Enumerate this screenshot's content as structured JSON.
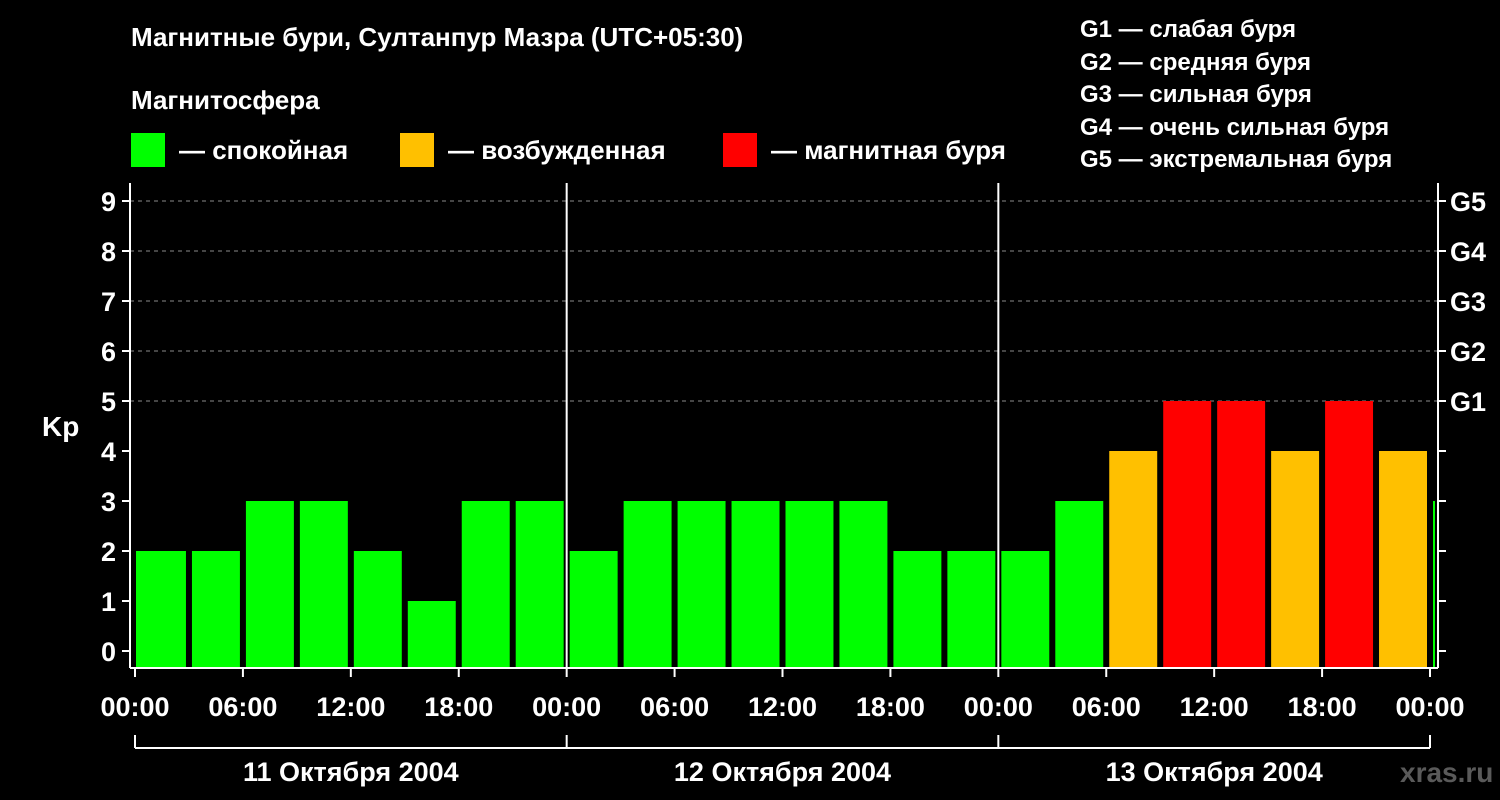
{
  "header": {
    "title": "Магнитные бури, Султанпур Мазра (UTC+05:30)",
    "subtitle": "Магнитосфера"
  },
  "legend": [
    {
      "label": "— спокойная",
      "color": "#00ff00"
    },
    {
      "label": "— возбужденная",
      "color": "#ffc000"
    },
    {
      "label": "— магнитная буря",
      "color": "#ff0000"
    }
  ],
  "g_scale": [
    "G1 — слабая буря",
    "G2 — средняя буря",
    "G3 — сильная буря",
    "G4 — очень сильная буря",
    "G5 — экстремальная буря"
  ],
  "watermark": "xras.ru",
  "colors": {
    "quiet": "#00ff00",
    "active": "#ffc000",
    "storm": "#ff0000"
  },
  "chart_data": {
    "type": "bar",
    "ylabel": "Kp",
    "ylim": [
      0,
      9
    ],
    "yticks": [
      "0",
      "1",
      "2",
      "3",
      "4",
      "5",
      "6",
      "7",
      "8",
      "9"
    ],
    "g_ticks": [
      {
        "kp": 5,
        "label": "G1"
      },
      {
        "kp": 6,
        "label": "G2"
      },
      {
        "kp": 7,
        "label": "G3"
      },
      {
        "kp": 8,
        "label": "G4"
      },
      {
        "kp": 9,
        "label": "G5"
      }
    ],
    "x_tick_labels": [
      "00:00",
      "06:00",
      "12:00",
      "18:00",
      "00:00",
      "06:00",
      "12:00",
      "18:00",
      "00:00",
      "06:00",
      "12:00",
      "18:00",
      "00:00"
    ],
    "days": [
      "11 Октября 2004",
      "12 Октября 2004",
      "13 Октября 2004"
    ],
    "interval_hours": 3,
    "values": [
      2,
      2,
      3,
      3,
      2,
      1,
      3,
      3,
      2,
      3,
      3,
      3,
      3,
      3,
      2,
      2,
      2,
      3,
      4,
      5,
      5,
      4,
      5,
      4,
      3
    ],
    "grid": "dashed horizontal"
  }
}
